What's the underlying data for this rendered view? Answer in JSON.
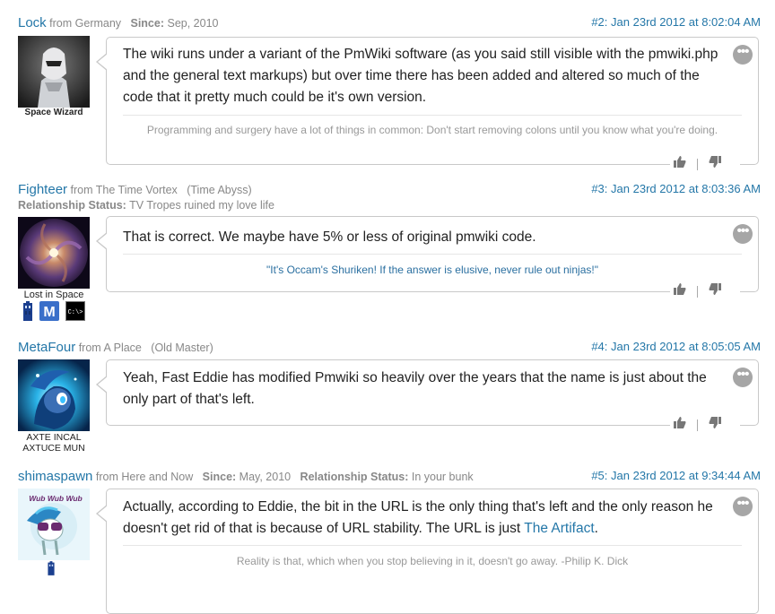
{
  "posts": [
    {
      "username": "Lock",
      "from_label": "from",
      "location": "Germany",
      "since_label": "Since:",
      "since": "Sep, 2010",
      "post_number": "#2:",
      "timestamp": "Jan 23rd 2012 at 8:02:04 AM",
      "avatar_title": "Space Wizard",
      "body": "The wiki runs under a variant of the PmWiki software (as you said still visible with the pmwiki.php and the general text markups) but over time there has been added and altered so much of the code that it pretty much could be it's own version.",
      "signature": "Programming and surgery have a lot of things in common: Don't start removing colons until you know what you're doing."
    },
    {
      "username": "Fighteer",
      "from_label": "from",
      "location": "The Time Vortex",
      "rank": "(Time Abyss)",
      "relationship_label": "Relationship Status:",
      "relationship": "TV Tropes ruined my love life",
      "post_number": "#3:",
      "timestamp": "Jan 23rd 2012 at 8:03:36 AM",
      "avatar_title": "Lost in Space",
      "body": "That is correct. We maybe have 5% or less of original pmwiki code.",
      "signature": "\"It's Occam's Shuriken! If the answer is elusive, never rule out ninjas!\""
    },
    {
      "username": "MetaFour",
      "from_label": "from",
      "location": "A Place",
      "rank": "(Old Master)",
      "post_number": "#4:",
      "timestamp": "Jan 23rd 2012 at 8:05:05 AM",
      "avatar_title": "AXTE INCAL AXTUCE MUN",
      "body": "Yeah, Fast Eddie has modified Pmwiki so heavily over the years that the name is just about the only part of that's left."
    },
    {
      "username": "shimaspawn",
      "from_label": "from",
      "location": "Here and Now",
      "since_label": "Since:",
      "since": "May, 2010",
      "relationship_label": "Relationship Status:",
      "relationship": "In your bunk",
      "post_number": "#5:",
      "timestamp": "Jan 23rd 2012 at 9:34:44 AM",
      "avatar_text": "Wub Wub Wub",
      "body_prefix": "Actually, according to Eddie, the bit in the URL is the only thing that's left and the only reason he doesn't get rid of that is because of URL stability. The URL is just ",
      "body_link": "The Artifact",
      "body_suffix": ".",
      "signature": "Reality is that, which when you stop believing in it, doesn't go away. -Philip K. Dick"
    }
  ],
  "ui": {
    "more_glyph": "•••",
    "badge_medal": "M",
    "badge_terminal": "C:\\>"
  },
  "colors": {
    "link_blue": "#2477a8",
    "muted_gray": "#888888",
    "bubble_border": "#c9c9c9",
    "more_button": "#a6a6a6"
  },
  "icons": [
    "ellipsis-more-icon",
    "thumbs-up-icon",
    "thumbs-down-icon",
    "tardis-badge-icon",
    "medal-badge-icon",
    "terminal-badge-icon"
  ]
}
